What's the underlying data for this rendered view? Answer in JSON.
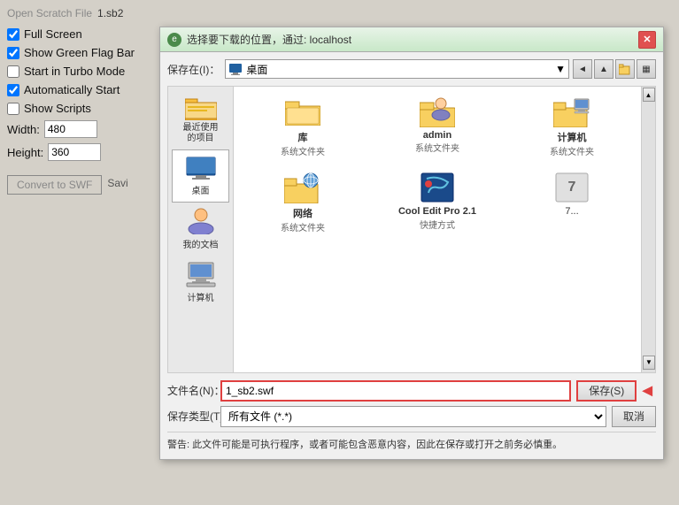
{
  "menu": {
    "open_file_label": "Open Scratch File",
    "filename": "1.sb2"
  },
  "options": {
    "full_screen": {
      "label": "Full Screen",
      "checked": true
    },
    "show_green_flag": {
      "label": "Show Green Flag Bar",
      "checked": true
    },
    "start_turbo": {
      "label": "Start in Turbo Mode",
      "checked": false
    },
    "auto_start": {
      "label": "Automatically Start",
      "checked": true
    },
    "show_scripts": {
      "label": "Show Scripts",
      "checked": false
    }
  },
  "fields": {
    "width_label": "Width:",
    "width_value": "480",
    "height_label": "Height:",
    "height_value": "360"
  },
  "convert_btn": "Convert to SWF",
  "saving_text": "Savi",
  "dialog": {
    "title": "选择要下载的位置，通过: localhost",
    "save_location_label": "保存在(I)：",
    "save_location_value": "桌面",
    "nav_back": "◄",
    "nav_up": "▲",
    "nav_new": "🗀",
    "nav_view": "▦",
    "sidebar_items": [
      {
        "id": "recent",
        "label": "最近使用的项目"
      },
      {
        "id": "desktop",
        "label": "桌面",
        "active": true
      },
      {
        "id": "documents",
        "label": "我的文档"
      },
      {
        "id": "computer",
        "label": "计算机"
      }
    ],
    "files": [
      {
        "name": "库",
        "type": "系统文件夹",
        "kind": "folder"
      },
      {
        "name": "admin",
        "type": "系统文件夹",
        "kind": "person-folder"
      },
      {
        "name": "计算机",
        "type": "系统文件夹",
        "kind": "pc-folder"
      },
      {
        "name": "网络",
        "type": "系统文件夹",
        "kind": "network-folder"
      },
      {
        "name": "Cool Edit Pro 2.1",
        "type": "快捷方式",
        "kind": "app"
      },
      {
        "name": "7...",
        "type": "",
        "kind": "app2"
      }
    ],
    "filename_label": "文件名(N)：",
    "filename_value": "1_sb2.swf",
    "filetype_label": "保存类型(T)：",
    "filetype_value": "所有文件 (*.*)",
    "save_button": "保存(S)",
    "cancel_button": "取消",
    "warning_text": "警告: 此文件可能是可执行程序，或者可能包含恶意内容，因此在保存或打开之前务必慎重。"
  }
}
